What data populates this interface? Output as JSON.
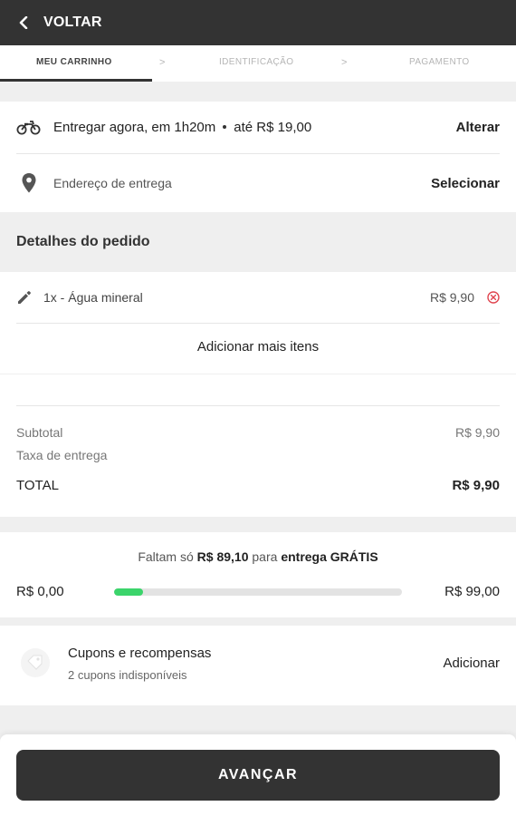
{
  "header": {
    "back_label": "VOLTAR",
    "back_icon": "chevron-left-icon"
  },
  "steps": [
    {
      "label": "MEU CARRINHO",
      "active": true
    },
    {
      "label": "IDENTIFICAÇÃO",
      "active": false
    },
    {
      "label": "PAGAMENTO",
      "active": false
    }
  ],
  "step_separator": ">",
  "delivery": {
    "icon": "motorcycle-icon",
    "text": "Entregar agora, em 1h20m",
    "price_text": "até R$ 19,00",
    "action": "Alterar"
  },
  "address": {
    "icon": "map-pin-icon",
    "label": "Endereço de entrega",
    "action": "Selecionar"
  },
  "order": {
    "title": "Detalhes do pedido",
    "items": [
      {
        "icon": "pencil-icon",
        "name": "1x - Água mineral",
        "price": "R$ 9,90",
        "remove_icon": "close-circle-icon"
      }
    ],
    "add_more": "Adicionar mais itens"
  },
  "summary": {
    "subtotal_label": "Subtotal",
    "subtotal_value": "R$ 9,90",
    "fee_label": "Taxa de entrega",
    "total_label": "TOTAL",
    "total_value": "R$ 9,90"
  },
  "free_shipping": {
    "prefix": "Faltam só",
    "amount": "R$ 89,10",
    "middle": "para",
    "suffix": "entrega GRÁTIS",
    "min_label": "R$ 0,00",
    "max_label": "R$ 99,00",
    "progress": 0.1
  },
  "coupons": {
    "icon": "coupon-tag-icon",
    "title": "Cupons e recompensas",
    "subtitle": "2 cupons indisponíveis",
    "action": "Adicionar"
  },
  "footer": {
    "button_label": "AVANÇAR"
  },
  "colors": {
    "dark": "#333333",
    "progress": "#3bd46b",
    "remove": "#e0454f",
    "background": "#efefef"
  }
}
